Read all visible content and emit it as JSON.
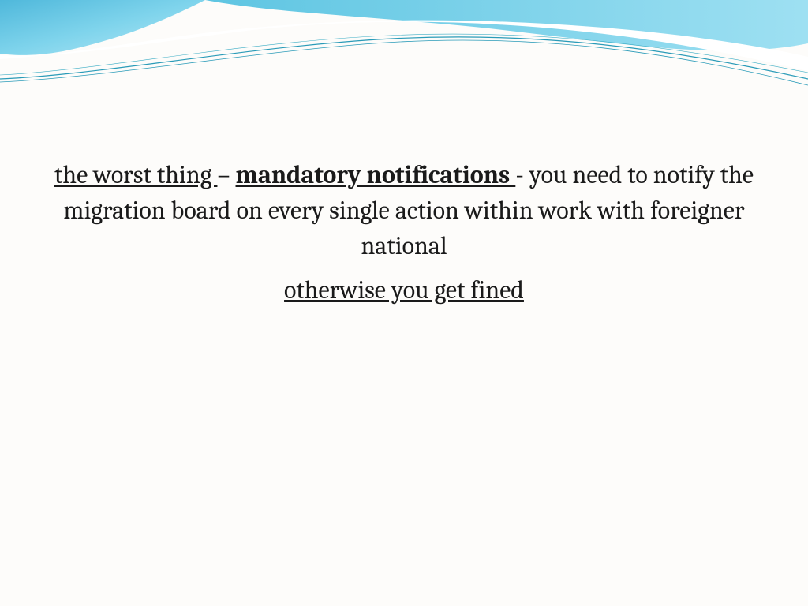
{
  "slide": {
    "p1_part1": "the worst thing ",
    "p1_dash": "– ",
    "p1_part2": "mandatory notifications ",
    "p1_part3": " - you need to notify the migration board on every single action within work with foreigner national",
    "p2": "otherwise you get fined"
  },
  "theme": {
    "wave_fill": "#6fcce8",
    "wave_gradient_start": "#4fb8db",
    "wave_gradient_end": "#a8e0f0",
    "thin_line": "#2a9bb8"
  }
}
